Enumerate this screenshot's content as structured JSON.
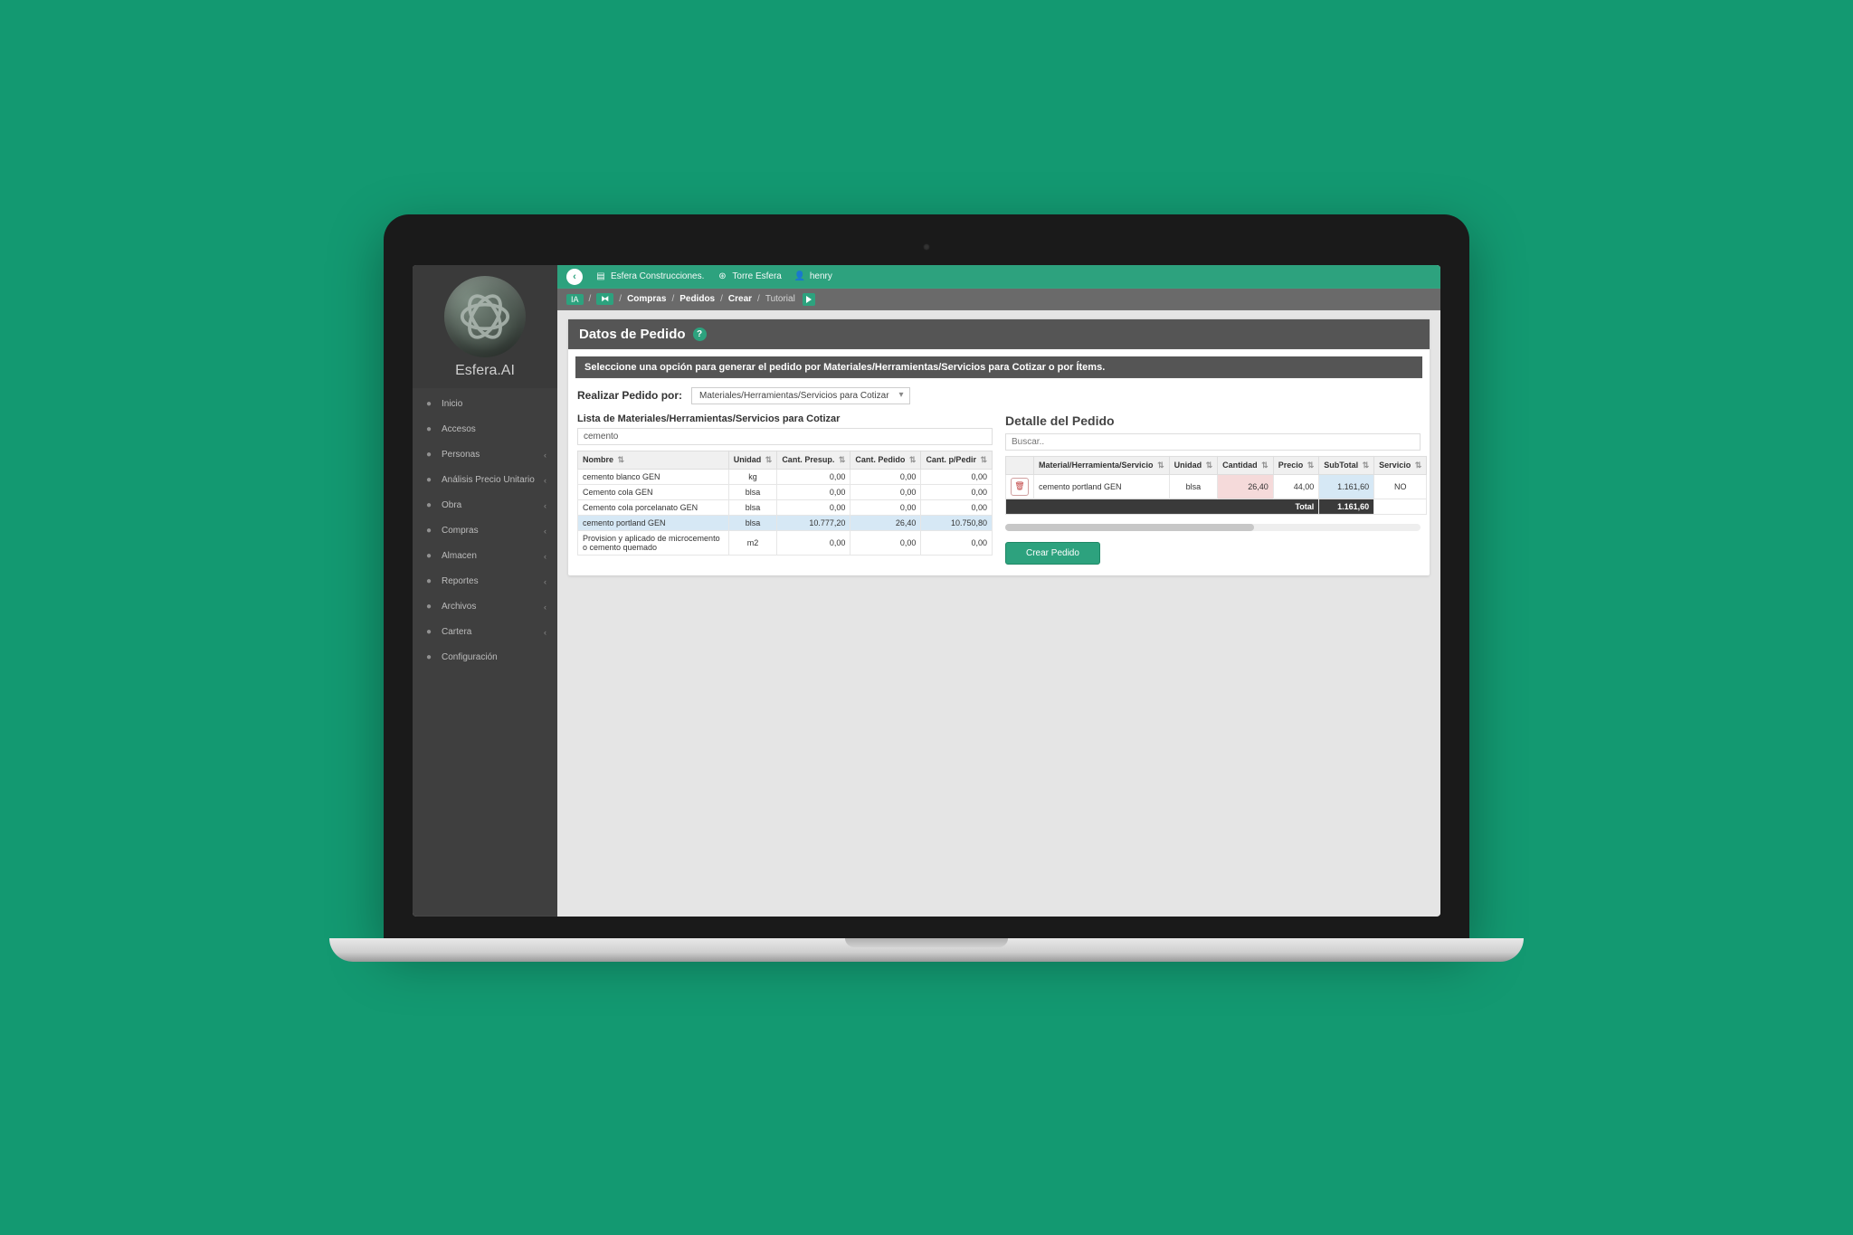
{
  "brand": "Esfera.AI",
  "topbar": {
    "company": "Esfera Construcciones.",
    "project": "Torre Esfera",
    "user": "henry"
  },
  "breadcrumb": {
    "badge": "IA",
    "items": [
      "Compras",
      "Pedidos",
      "Crear"
    ],
    "trailing": "Tutorial"
  },
  "sidebar": [
    {
      "label": "Inicio",
      "chev": false
    },
    {
      "label": "Accesos",
      "chev": false
    },
    {
      "label": "Personas",
      "chev": true
    },
    {
      "label": "Análisis Precio Unitario",
      "chev": true
    },
    {
      "label": "Obra",
      "chev": true
    },
    {
      "label": "Compras",
      "chev": true
    },
    {
      "label": "Almacen",
      "chev": true
    },
    {
      "label": "Reportes",
      "chev": true
    },
    {
      "label": "Archivos",
      "chev": true
    },
    {
      "label": "Cartera",
      "chev": true
    },
    {
      "label": "Configuración",
      "chev": false
    }
  ],
  "page": {
    "title": "Datos de Pedido",
    "instruction": "Seleccione una opción para generar el pedido por Materiales/Herramientas/Servicios para Cotizar o por Ítems.",
    "selector_label": "Realizar Pedido por:",
    "selector_value": "Materiales/Herramientas/Servicios para Cotizar",
    "list_title": "Lista de Materiales/Herramientas/Servicios para Cotizar",
    "search_value": "cemento",
    "list_headers": [
      "Nombre",
      "Unidad",
      "Cant. Presup.",
      "Cant. Pedido",
      "Cant. p/Pedir"
    ],
    "list_rows": [
      {
        "n": "cemento blanco GEN",
        "u": "kg",
        "cp": "0,00",
        "cpe": "0,00",
        "cpp": "0,00",
        "hl": false
      },
      {
        "n": "Cemento cola GEN",
        "u": "blsa",
        "cp": "0,00",
        "cpe": "0,00",
        "cpp": "0,00",
        "hl": false
      },
      {
        "n": "Cemento cola porcelanato GEN",
        "u": "blsa",
        "cp": "0,00",
        "cpe": "0,00",
        "cpp": "0,00",
        "hl": false
      },
      {
        "n": "cemento portland GEN",
        "u": "blsa",
        "cp": "10.777,20",
        "cpe": "26,40",
        "cpp": "10.750,80",
        "hl": true
      },
      {
        "n": "Provision y aplicado de microcemento o cemento quemado",
        "u": "m2",
        "cp": "0,00",
        "cpe": "0,00",
        "cpp": "0,00",
        "hl": false
      }
    ],
    "detail_title": "Detalle del Pedido",
    "detail_search_placeholder": "Buscar..",
    "detail_headers": [
      "",
      "Material/Herramienta/Servicio",
      "Unidad",
      "Cantidad",
      "Precio",
      "SubTotal",
      "Servicio"
    ],
    "detail_rows": [
      {
        "mat": "cemento portland GEN",
        "u": "blsa",
        "cant": "26,40",
        "precio": "44,00",
        "sub": "1.161,60",
        "serv": "NO"
      }
    ],
    "total_label": "Total",
    "total_value": "1.161,60",
    "create_btn": "Crear Pedido"
  }
}
